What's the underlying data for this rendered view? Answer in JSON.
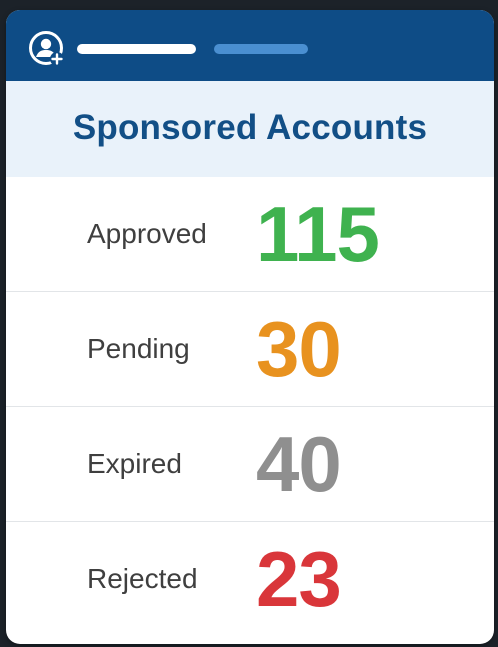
{
  "header": {
    "avatar_icon": "user-add-icon",
    "title": "Sponsored Accounts"
  },
  "colors": {
    "header_bg": "#0e4c86",
    "title_band_bg": "#e9f2fa",
    "title_color": "#124f86",
    "approved": "#3fb24f",
    "pending": "#e8921f",
    "expired": "#8f8f8f",
    "rejected": "#d9363a"
  },
  "stats": [
    {
      "label": "Approved",
      "value": "115",
      "status": "approved"
    },
    {
      "label": "Pending",
      "value": "30",
      "status": "pending"
    },
    {
      "label": "Expired",
      "value": "40",
      "status": "expired"
    },
    {
      "label": "Rejected",
      "value": "23",
      "status": "rejected"
    }
  ]
}
